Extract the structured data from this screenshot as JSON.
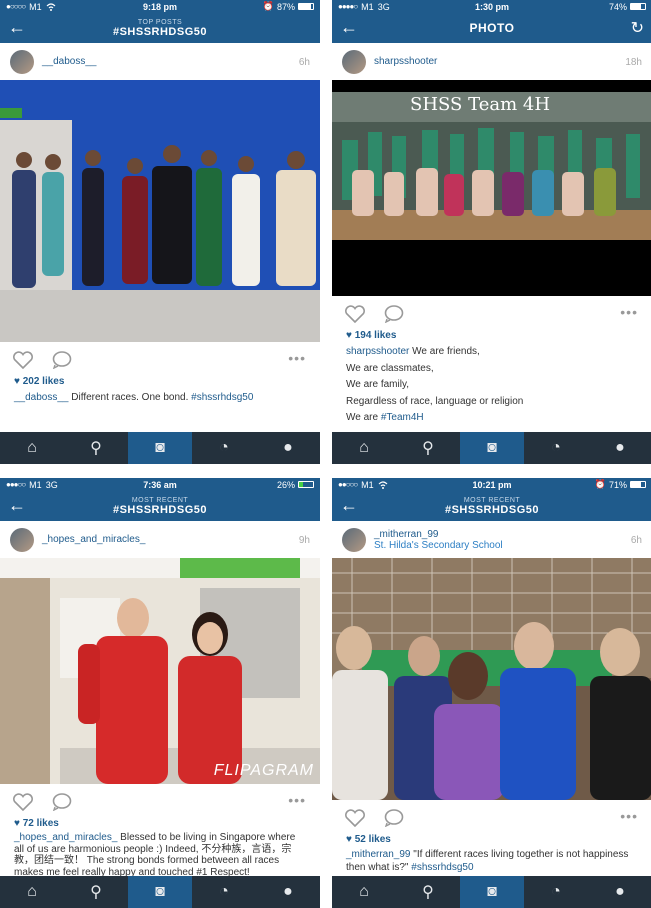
{
  "panels": [
    {
      "status": {
        "dots": "●○○○○",
        "carrier": "M1",
        "signal": "wifi",
        "time": "9:18 pm",
        "battery": "87%",
        "battery_level": 0.87
      },
      "nav": {
        "subtitle": "TOP POSTS",
        "title": "#SHSSRHDSG50"
      },
      "post": {
        "username": "__daboss__",
        "location": "",
        "age": "6h",
        "likes": "202 likes",
        "caption_user": "__daboss__",
        "caption_text": " Different races. One bond. ",
        "caption_tag": "#shssrhdsg50"
      }
    },
    {
      "status": {
        "dots": "●●●●○",
        "carrier": "M1",
        "network": "3G",
        "time": "1:30 pm",
        "battery": "74%",
        "battery_level": 0.74
      },
      "nav": {
        "subtitle": "",
        "title": "PHOTO"
      },
      "post": {
        "username": "sharpsshooter",
        "location": "",
        "age": "18h",
        "likes": "194 likes",
        "overlay": "SHSS Team 4H",
        "caption_user": "sharpsshooter",
        "caption_lines": [
          "We are friends,",
          "We are classmates,",
          "We are family,",
          "Regardless of race, language or religion"
        ],
        "caption_last_prefix": "We are ",
        "caption_last_tag": "#Team4H"
      }
    },
    {
      "status": {
        "dots": "●●●○○",
        "carrier": "M1",
        "network": "3G",
        "time": "7:36 am",
        "battery": "26%",
        "battery_level": 0.26
      },
      "nav": {
        "subtitle": "MOST RECENT",
        "title": "#SHSSRHDSG50"
      },
      "post": {
        "username": "_hopes_and_miracles_",
        "location": "",
        "age": "9h",
        "likes": "72 likes",
        "overlay": "FLIPAGRAM",
        "caption_user": "_hopes_and_miracles_",
        "caption_text": " Blessed to be living in Singapore where all of us are harmonious people :) Indeed, 不分种族，言语，宗教，团结一致！ The strong bonds formed between all races makes me feel really happy and touched #1 Respect!"
      }
    },
    {
      "status": {
        "dots": "●●○○○",
        "carrier": "M1",
        "signal": "wifi",
        "time": "10:21 pm",
        "battery": "71%",
        "battery_level": 0.71
      },
      "nav": {
        "subtitle": "MOST RECENT",
        "title": "#SHSSRHDSG50"
      },
      "post": {
        "username": "_mitherran_99",
        "location": "St. Hilda's Secondary School",
        "age": "6h",
        "likes": "52 likes",
        "caption_user": "_mitherran_99",
        "caption_text": " \"If different races living together is not happiness then what is?\" ",
        "caption_tag": "#shssrhdsg50"
      }
    }
  ],
  "tabbar": {
    "icons": [
      "home-icon",
      "search-icon",
      "camera-icon",
      "activity-icon",
      "profile-icon"
    ],
    "active": "camera-icon"
  },
  "colors": {
    "nav": "#1f5b8c",
    "tabbar": "#24313d",
    "link": "#1f5b8c"
  }
}
